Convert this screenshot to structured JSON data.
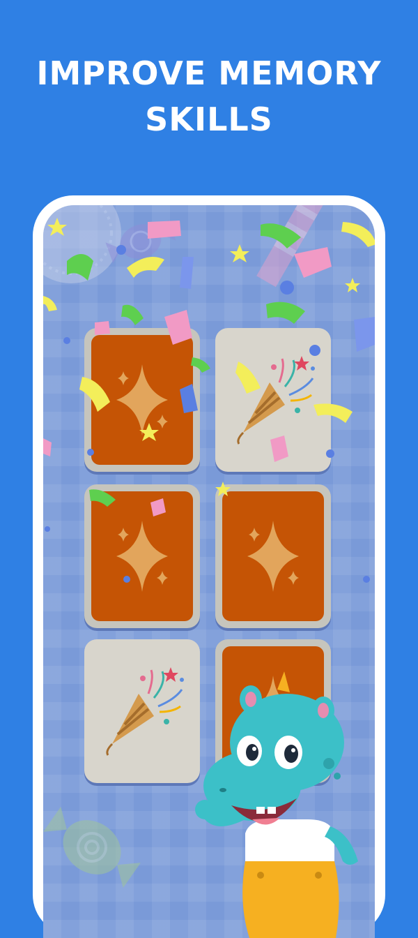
{
  "headline": {
    "line1": "IMPROVE MEMORY",
    "line2": "SKILLS"
  },
  "colors": {
    "background": "#2f80e4",
    "phone_frame": "#ffffff",
    "card_back": "#c55405",
    "card_front": "#d8d5cc",
    "mascot": "#3cc0c8",
    "overalls": "#f6b021"
  },
  "game": {
    "cards": [
      {
        "state": "face-down",
        "icon": "sparkle-icon"
      },
      {
        "state": "face-up",
        "icon": "party-popper-icon"
      },
      {
        "state": "face-down",
        "icon": "sparkle-icon"
      },
      {
        "state": "face-down",
        "icon": "sparkle-icon"
      },
      {
        "state": "face-up",
        "icon": "party-popper-icon"
      },
      {
        "state": "face-down",
        "icon": "sparkle-icon"
      }
    ],
    "mascot": "hippo-mascot",
    "effect": "confetti"
  }
}
